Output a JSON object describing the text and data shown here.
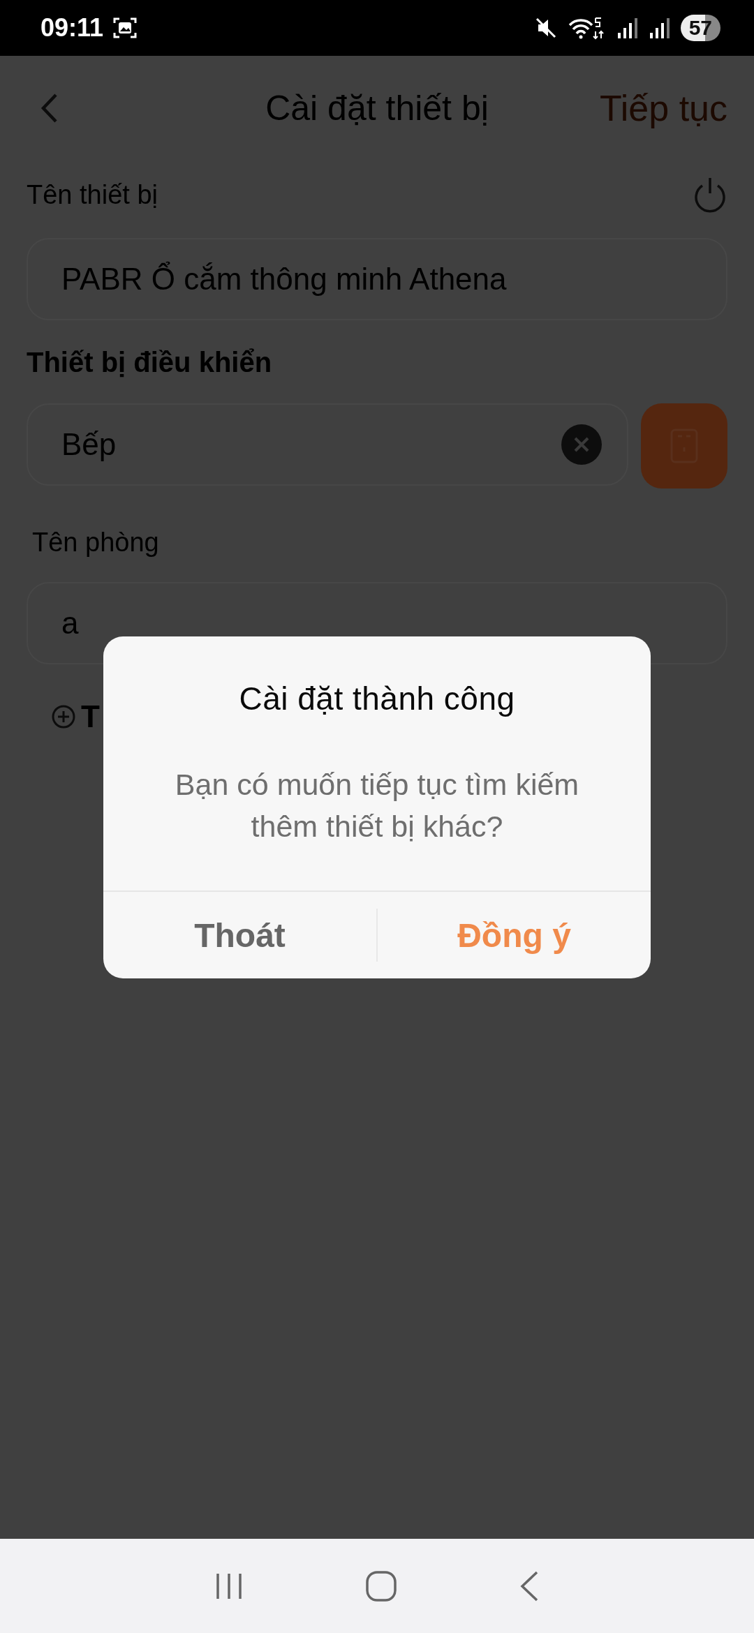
{
  "status_bar": {
    "time": "09:11",
    "battery": "57"
  },
  "header": {
    "title": "Cài đặt thiết bị",
    "action": "Tiếp tục"
  },
  "device_name": {
    "label": "Tên thiết bị",
    "value": "PABR Ổ cắm thông minh Athena"
  },
  "controller": {
    "label": "Thiết bị điều khiển",
    "value": "Bếp"
  },
  "room": {
    "label": "Tên phòng",
    "value": "a"
  },
  "add_item": {
    "label": "T"
  },
  "dialog": {
    "title": "Cài đặt thành công",
    "message": "Bạn có muốn tiếp tục tìm kiếm\nthêm thiết bị khác?",
    "buttons": [
      {
        "label": "Thoát",
        "kind": "cancel"
      },
      {
        "label": "Đồng ý",
        "kind": "confirm"
      }
    ]
  }
}
